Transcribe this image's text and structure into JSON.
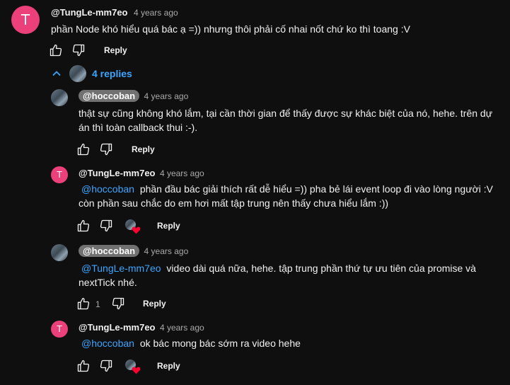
{
  "top_comment": {
    "avatar_letter": "T",
    "author": "@TungLe-mm7eo",
    "time": "4 years ago",
    "text": "phần Node khó hiểu quá bác ạ =)) nhưng thôi phải cố nhai nốt chứ ko thì toang :V",
    "reply_label": "Reply"
  },
  "replies_toggle": {
    "label": "4 replies"
  },
  "replies": [
    {
      "author": "@hoccoban",
      "time": "4 years ago",
      "lines": [
        "thật sự cũng không khó lắm, tại cần thời gian để thấy được sự khác biệt của nó, hehe. trên dự",
        "án thì toàn callback thui :-)."
      ],
      "reply_label": "Reply"
    },
    {
      "avatar_letter": "T",
      "author": "@TungLe-mm7eo",
      "time": "4 years ago",
      "mention": "@hoccoban",
      "line1_rest": "phần đầu bác giải thích rất dễ hiểu =)) pha bẻ lái event loop đi vào lòng người :V",
      "line2": "còn phần sau chắc do em hơi mất tập trung nên thấy chưa hiểu lắm :))",
      "reply_label": "Reply"
    },
    {
      "author": "@hoccoban",
      "time": "4 years ago",
      "mention": "@TungLe-mm7eo",
      "line1_rest": "video dài quá nữa, hehe. tập trung phần thứ tự ưu tiên của promise và",
      "line2": "nextTick nhé.",
      "like_count": "1",
      "reply_label": "Reply"
    },
    {
      "avatar_letter": "T",
      "author": "@TungLe-mm7eo",
      "time": "4 years ago",
      "mention": "@hoccoban",
      "line1_rest": "ok bác mong bác sớm ra video hehe",
      "reply_label": "Reply"
    }
  ],
  "colors": {
    "background": "#0f0f0f",
    "mention": "#3ea6ff",
    "avatar_pink": "#ec407a",
    "heart": "#ff0033"
  }
}
